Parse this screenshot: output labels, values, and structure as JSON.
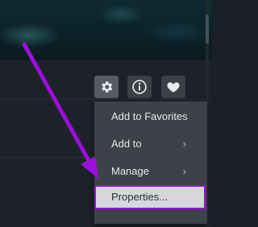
{
  "menu": {
    "items": [
      {
        "label": "Add to Favorites"
      },
      {
        "label": "Add to",
        "chevron": "›"
      },
      {
        "label": "Manage",
        "chevron": "›"
      },
      {
        "label": "Properties..."
      }
    ]
  },
  "icons": [
    "gear-icon",
    "info-icon",
    "heart-icon"
  ],
  "colors": {
    "annotation": "#9a10d8",
    "menu_bg": "#3d4249",
    "highlight_bg": "#d5d7da"
  }
}
